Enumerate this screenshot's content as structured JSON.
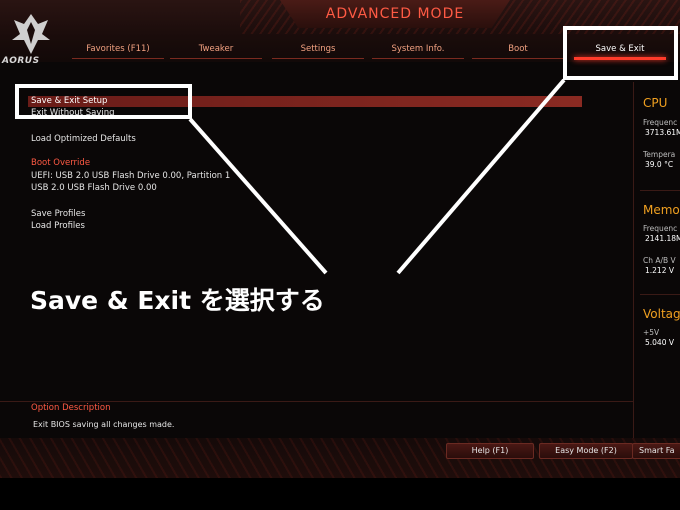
{
  "header": {
    "mode_title": "ADVANCED MODE",
    "brand": "AORUS",
    "tabs": [
      {
        "label": "Favorites (F11)"
      },
      {
        "label": "Tweaker"
      },
      {
        "label": "Settings"
      },
      {
        "label": "System Info."
      },
      {
        "label": "Boot"
      },
      {
        "label": "Save & Exit",
        "active": true
      }
    ]
  },
  "menu": {
    "save_exit_setup": "Save & Exit Setup",
    "exit_without_saving": "Exit Without Saving",
    "load_optimized_defaults": "Load Optimized Defaults",
    "boot_override_header": "Boot Override",
    "boot_override_items": [
      "UEFI: USB 2.0 USB Flash Drive 0.00, Partition 1",
      "USB 2.0 USB Flash Drive 0.00"
    ],
    "save_profiles": "Save Profiles",
    "load_profiles": "Load Profiles"
  },
  "right_panel": {
    "cpu": {
      "title": "CPU",
      "frequency_label": "Frequenc",
      "frequency_value": "3713.61M",
      "temperature_label": "Tempera",
      "temperature_value": "39.0 °C"
    },
    "memory": {
      "title": "Memo",
      "frequency_label": "Frequenc",
      "frequency_value": "2141.18M",
      "voltage_label": "Ch A/B V",
      "voltage_value": "1.212 V"
    },
    "voltage": {
      "title": "Voltag",
      "label": "+5V",
      "value": "5.040 V"
    }
  },
  "option_description": {
    "header": "Option Description",
    "text": "Exit BIOS saving all changes made."
  },
  "bottom_buttons": [
    "Help (F1)",
    "Easy Mode (F2)",
    "Smart Fa"
  ],
  "annotation": {
    "caption": "Save & Exit を選択する"
  },
  "colors": {
    "accent": "#ff3b2a",
    "section_header": "#ff5a44",
    "panel_title": "#f0a020",
    "selection": "#7a2420",
    "annotation": "#ffffff"
  }
}
